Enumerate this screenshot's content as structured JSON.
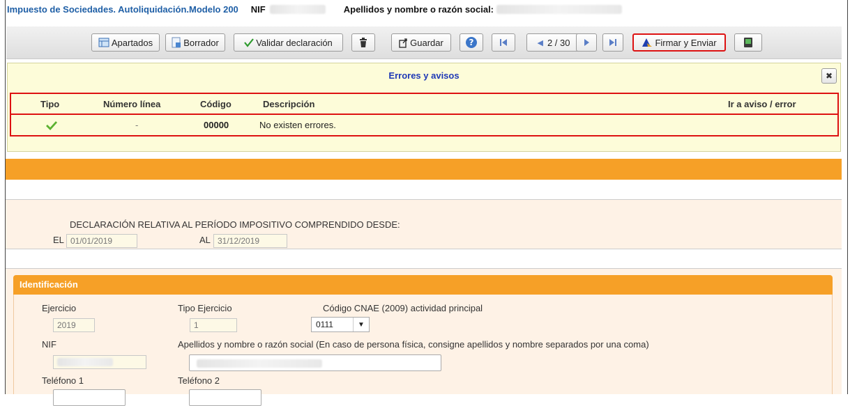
{
  "header": {
    "title": "Impuesto de Sociedades. Autoliquidación.Modelo 200",
    "nif_label": "NIF",
    "name_label": "Apellidos y nombre o razón social:"
  },
  "toolbar": {
    "apartados": "Apartados",
    "borrador": "Borrador",
    "validar": "Validar declaración",
    "guardar": "Guardar",
    "page": "2 / 30",
    "firmar": "Firmar y Enviar"
  },
  "errors": {
    "title": "Errores y avisos",
    "columns": {
      "tipo": "Tipo",
      "numero_linea": "Número línea",
      "codigo": "Código",
      "descripcion": "Descripción",
      "ir_a": "Ir a aviso / error"
    },
    "rows": [
      {
        "numero_linea": "-",
        "codigo": "00000",
        "descripcion": "No existen errores."
      }
    ]
  },
  "period": {
    "label": "DECLARACIÓN RELATIVA AL PERÍODO IMPOSITIVO COMPRENDIDO DESDE:",
    "el_label": "EL",
    "el_value": "01/01/2019",
    "al_label": "AL",
    "al_value": "31/12/2019"
  },
  "identificacion": {
    "title": "Identificación",
    "ejercicio_label": "Ejercicio",
    "ejercicio_value": "2019",
    "tipo_ejercicio_label": "Tipo Ejercicio",
    "tipo_ejercicio_value": "1",
    "cnae_label": "Código CNAE (2009) actividad principal",
    "cnae_value": "0111",
    "nif_label": "NIF",
    "nombre_label": "Apellidos y nombre o razón social (En caso de persona física, consigne apellidos y nombre separados por una coma)",
    "telefono1_label": "Teléfono 1",
    "telefono2_label": "Teléfono 2"
  },
  "colors": {
    "accent_orange": "#f6a027",
    "title_blue": "#1f5fa6",
    "highlight_red": "#dd1111",
    "panel_yellow": "#fdfcd9",
    "form_bg": "#fef2e6"
  }
}
